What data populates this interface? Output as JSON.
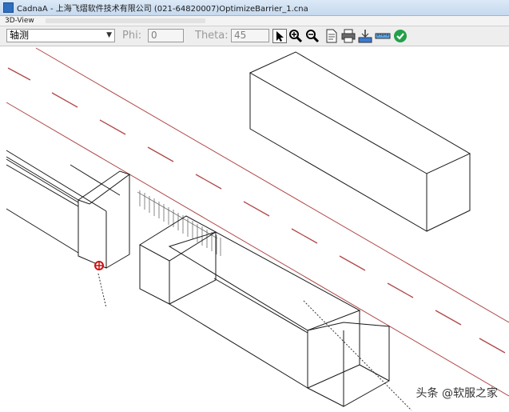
{
  "window": {
    "title": "CadnaA - 上海飞熠软件技术有限公司 (021-64820007)OptimizeBarrier_1.cna",
    "menu_label": "3D-View"
  },
  "toolbar": {
    "view_mode": "轴测",
    "phi_label": "Phi:",
    "phi_value": "0",
    "theta_label": "Theta:",
    "theta_value": "45",
    "icons": [
      "pointer-icon",
      "zoom-in-icon",
      "zoom-out-icon",
      "document-icon",
      "print-icon",
      "level-icon",
      "ruler-icon",
      "ok-check-icon"
    ]
  },
  "watermark": "头条 @软服之家",
  "colors": {
    "road_line": "#b04848",
    "box_line": "#1a1a1a",
    "accent_ok": "#22a04a"
  }
}
